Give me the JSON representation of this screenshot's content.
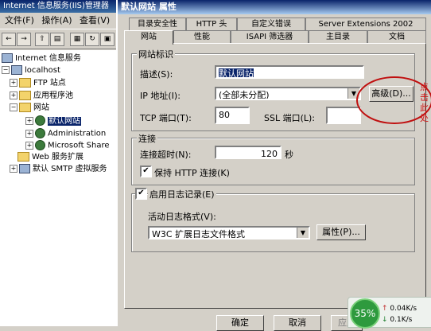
{
  "iis": {
    "title": "Internet 信息服务(IIS)管理器",
    "menu": [
      "文件(F)",
      "操作(A)",
      "查看(V)"
    ],
    "tree": [
      {
        "label": "Internet 信息服务"
      },
      {
        "label": "localhost"
      },
      {
        "label": "FTP 站点"
      },
      {
        "label": "应用程序池"
      },
      {
        "label": "网站"
      },
      {
        "label": "默认网站"
      },
      {
        "label": "Administration"
      },
      {
        "label": "Microsoft Share"
      },
      {
        "label": "Web 服务扩展"
      },
      {
        "label": "默认 SMTP 虚拟服务"
      }
    ]
  },
  "dialog": {
    "title": "默认网站 属性",
    "tabs_row1": [
      "目录安全性",
      "HTTP 头",
      "自定义错误",
      "Server Extensions 2002"
    ],
    "tabs_row2": [
      "网站",
      "性能",
      "ISAPI 筛选器",
      "主目录",
      "文档"
    ],
    "site_group": {
      "title": "网站标识",
      "desc_label": "描述(S):",
      "desc_value": "默认网站",
      "ip_label": "IP 地址(I):",
      "ip_value": "(全部未分配)",
      "advanced_button": "高级(D)...",
      "tcp_label": "TCP 端口(T):",
      "tcp_value": "80",
      "ssl_label": "SSL 端口(L):",
      "ssl_value": ""
    },
    "conn_group": {
      "title": "连接",
      "timeout_label": "连接超时(N):",
      "timeout_value": "120",
      "timeout_unit": "秒",
      "keepalive_label": "保持 HTTP 连接(K)",
      "keepalive_checked": true
    },
    "log_group": {
      "title": "启用日志记录(E)",
      "enabled": true,
      "format_label": "活动日志格式(V):",
      "format_value": "W3C 扩展日志文件格式",
      "properties_button": "属性(P)..."
    },
    "buttons": {
      "ok": "确定",
      "cancel": "取消",
      "apply": "应用"
    },
    "annotation": "点击\n此处"
  },
  "network": {
    "percent": "35%",
    "up": "0.04K/s",
    "down": "0.1K/s"
  }
}
